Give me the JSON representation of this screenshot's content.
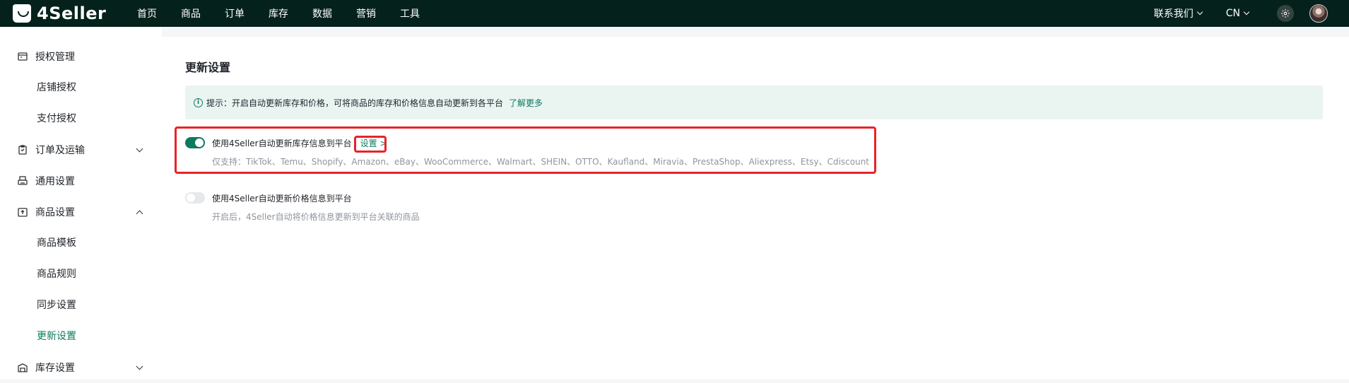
{
  "app": {
    "logo_text": "4Seller"
  },
  "topnav": {
    "items": [
      "首页",
      "商品",
      "订单",
      "库存",
      "数据",
      "营销",
      "工具"
    ],
    "contact": "联系我们",
    "lang": "CN"
  },
  "sidebar": {
    "group_auth": "授权管理",
    "auth_store": "店铺授权",
    "auth_pay": "支付授权",
    "group_order": "订单及运输",
    "group_general": "通用设置",
    "group_product": "商品设置",
    "prod_template": "商品模板",
    "prod_rules": "商品规则",
    "prod_sync": "同步设置",
    "prod_update": "更新设置",
    "group_stock": "库存设置"
  },
  "main": {
    "title": "更新设置",
    "tip_text": "提示：开启自动更新库存和价格，可将商品的库存和价格信息自动更新到各平台",
    "tip_link": "了解更多",
    "stock_setting": {
      "enabled": true,
      "label": "使用4Seller自动更新库存信息到平台",
      "link": "设置 >",
      "desc": "仅支持：TikTok、Temu、Shopify、Amazon、eBay、WooCommerce、Walmart、SHEIN、OTTO、Kaufland、Miravia、PrestaShop、Aliexpress、Etsy、Cdiscount"
    },
    "price_setting": {
      "enabled": false,
      "label": "使用4Seller自动更新价格信息到平台",
      "desc": "开启后，4Seller自动将价格信息更新到平台关联的商品"
    }
  },
  "colors": {
    "topbar_bg": "#05211b",
    "accent": "#0e7a5f",
    "highlight": "#e8232a"
  }
}
